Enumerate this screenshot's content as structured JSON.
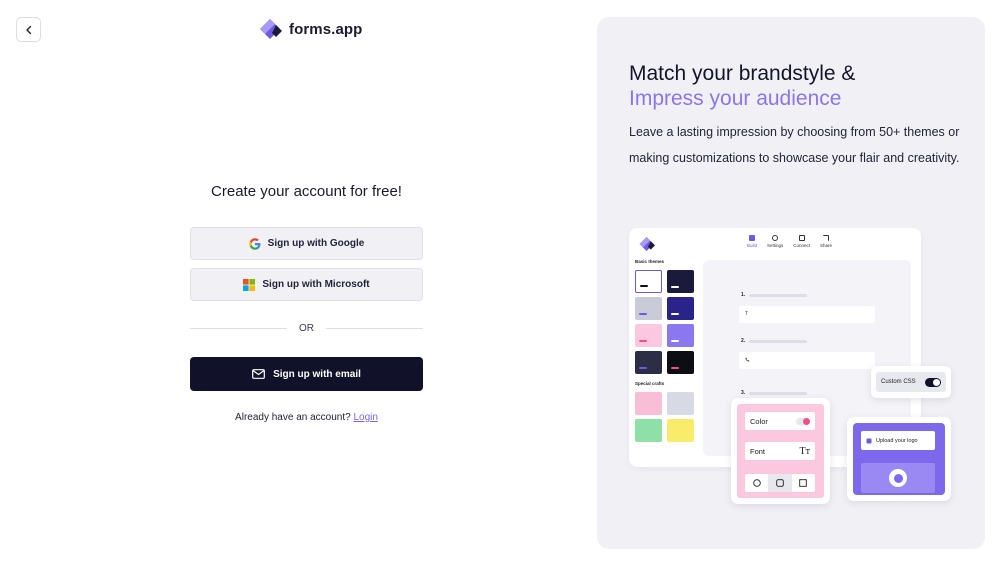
{
  "header": {
    "back_icon": "chevron-left-icon",
    "logo_icon": "forms-app-logo-icon",
    "logo_text": "forms.app"
  },
  "signup": {
    "heading": "Create your account for free!",
    "google_label": "Sign up with Google",
    "google_icon": "google-icon",
    "microsoft_label": "Sign up with Microsoft",
    "microsoft_icon": "microsoft-icon",
    "divider_text": "OR",
    "email_label": "Sign up with email",
    "email_icon": "envelope-icon",
    "login_prompt": "Already have an account?",
    "login_link": "Login"
  },
  "promo": {
    "title_line1": "Match your brandstyle &",
    "title_line2": "Impress your audience",
    "description": "Leave a lasting impression by choosing from 50+ themes or making customizations to showcase your flair and creativity.",
    "accent_color": "#8c75eb",
    "mockup": {
      "nav": [
        "Build",
        "Settings",
        "Connect",
        "Share"
      ],
      "basic_themes_label": "Basic themes",
      "special_crafts_label": "Special crafts",
      "questions": [
        "1.",
        "2.",
        "3."
      ],
      "q1_placeholder": "T",
      "custom_css_label": "Custom CSS",
      "color_label": "Color",
      "font_label": "Font",
      "font_icon": "Tт",
      "upload_logo_label": "Upload your logo"
    }
  },
  "colors": {
    "primary_dark": "#111129",
    "panel_bg": "#f1f1f5",
    "link": "#7a66e8"
  }
}
